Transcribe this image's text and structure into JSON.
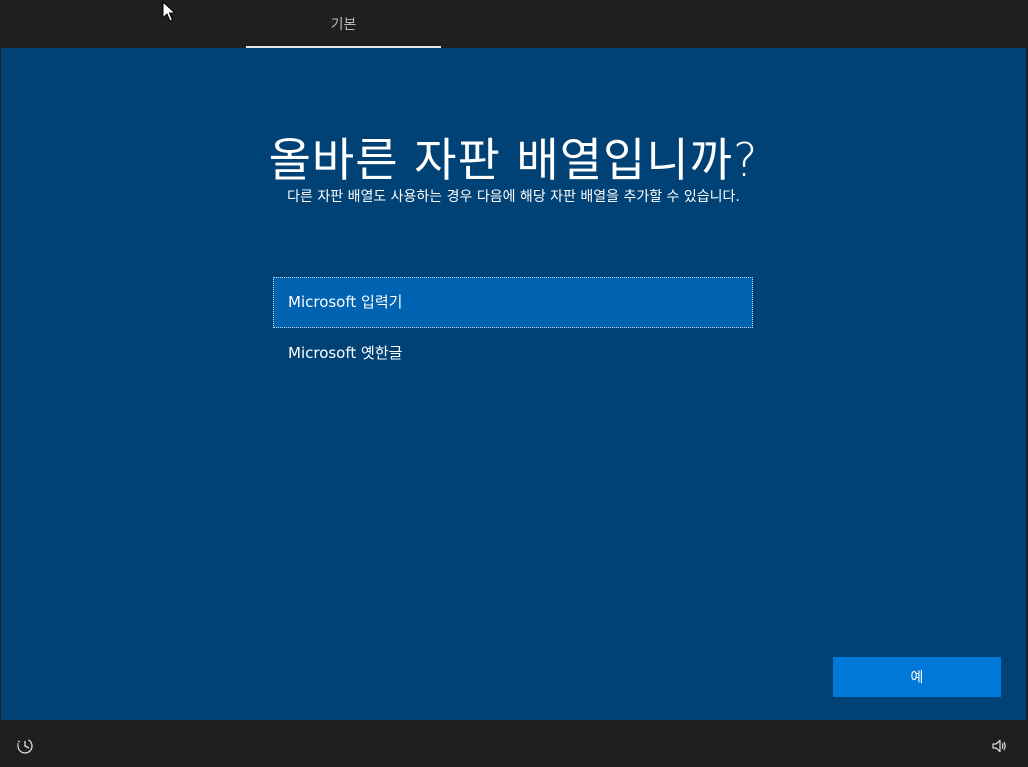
{
  "topbar": {
    "tab_label": "기본"
  },
  "main": {
    "title": "올바른 자판 배열입니까?",
    "subtitle": "다른 자판 배열도 사용하는 경우 다음에 해당 자판 배열을 추가할 수 있습니다.",
    "options": [
      {
        "label": "Microsoft 입력기",
        "selected": true
      },
      {
        "label": "Microsoft 옛한글",
        "selected": false
      }
    ],
    "yes_label": "예"
  },
  "bottombar": {
    "left_icon": "ease-of-access-icon",
    "right_icon": "volume-icon"
  },
  "colors": {
    "background": "#004275",
    "selected_item": "#0063b1",
    "primary_button": "#0078d7",
    "chrome": "#1f1f1f"
  }
}
